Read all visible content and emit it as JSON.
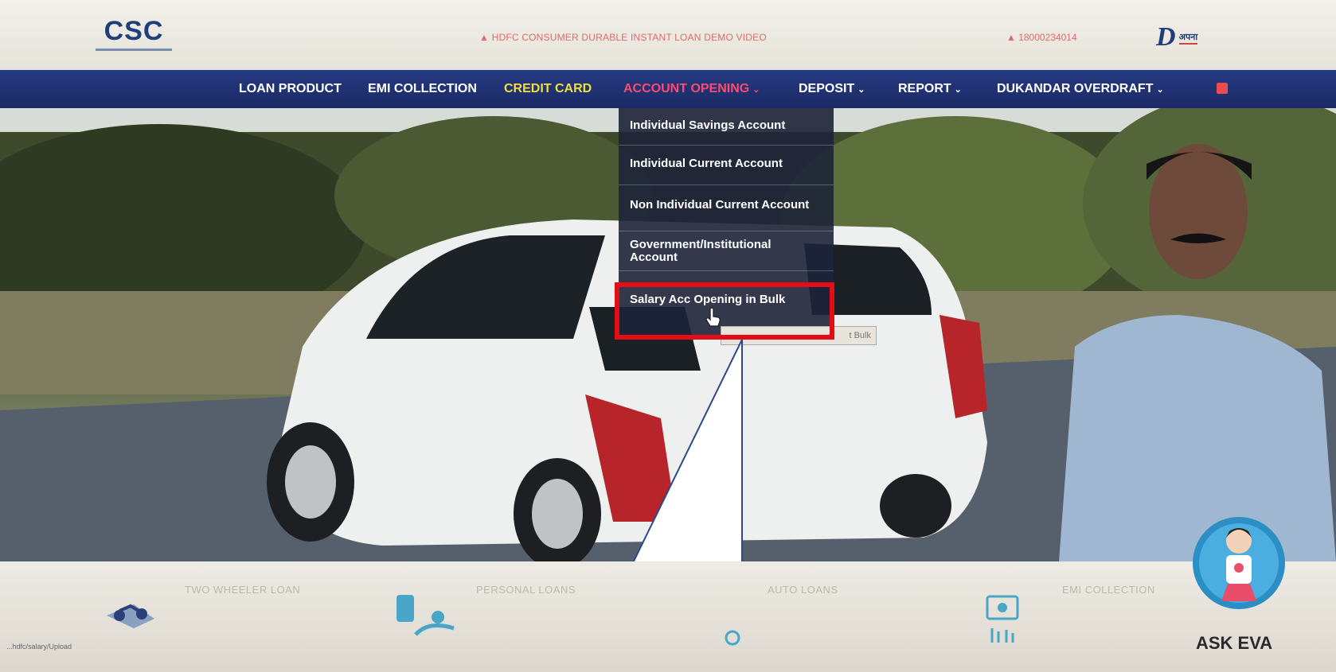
{
  "header": {
    "logo": "CSC",
    "promo": "▲ HDFC CONSUMER DURABLE INSTANT LOAN DEMO VIDEO",
    "phone": "▲ 18000234014",
    "partner_logo": "D",
    "partner_text": "अपना"
  },
  "nav": {
    "items": [
      {
        "label": "LOAN PRODUCT"
      },
      {
        "label": "EMI COLLECTION"
      },
      {
        "label": "CREDIT CARD"
      },
      {
        "label": "ACCOUNT OPENING"
      },
      {
        "label": "DEPOSIT"
      },
      {
        "label": "REPORT"
      },
      {
        "label": "DUKANDAR OVERDRAFT"
      }
    ],
    "chevron": "⌄",
    "active_color": "#ff4a6e",
    "highlight_color": "#f2df3a"
  },
  "dropdown": {
    "items": [
      {
        "label": "Individual Savings Account"
      },
      {
        "label": "Individual Current Account"
      },
      {
        "label": "Non Individual Current Account"
      },
      {
        "label": "Government/Institutional Account"
      },
      {
        "label": "Salary Acc Opening in Bulk"
      }
    ],
    "tooltip": "t Bulk"
  },
  "highlight_color": "#e30d17",
  "bottom": {
    "items": [
      {
        "label": "TWO WHEELER LOAN",
        "icon": "motorcycle-icon"
      },
      {
        "label": "PERSONAL LOANS",
        "icon": "money-hand-icon"
      },
      {
        "label": "AUTO LOANS",
        "icon": "car-icon"
      },
      {
        "label": "EMI COLLECTION",
        "icon": "card-icon"
      }
    ],
    "status_url": "...hdfc/salary/Upload",
    "ask_eva": "ASK EVA"
  }
}
